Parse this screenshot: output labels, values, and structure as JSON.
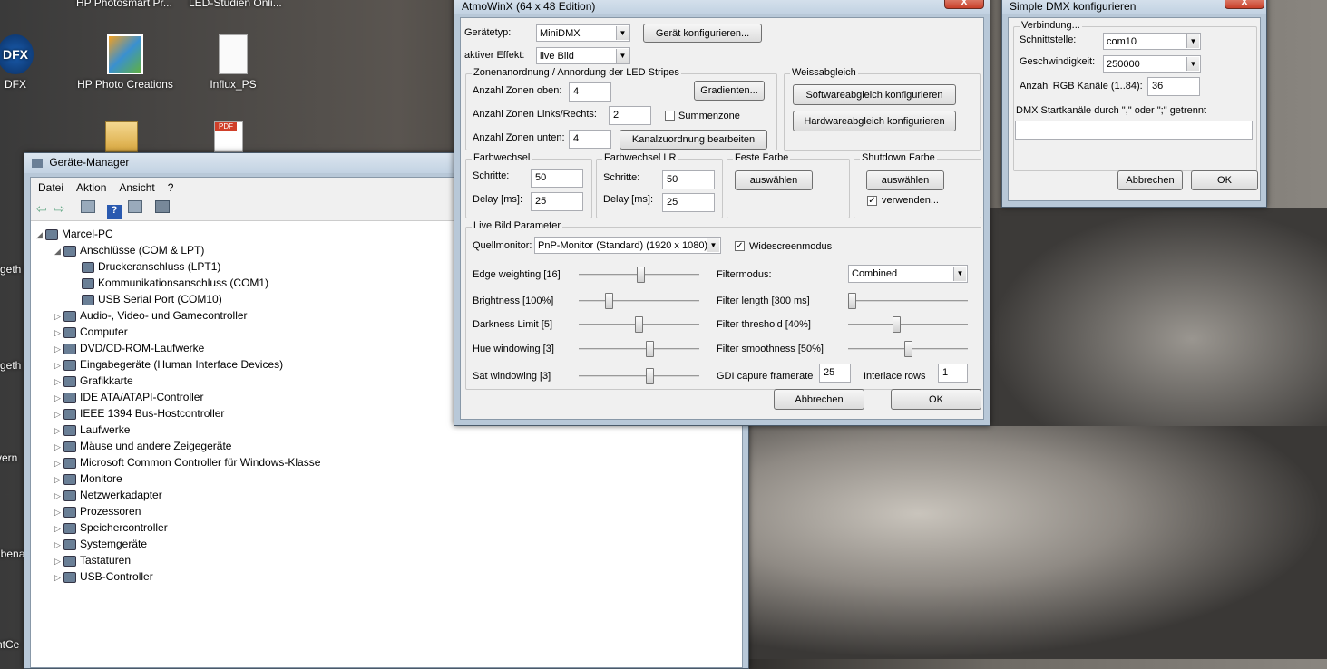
{
  "desktop": {
    "top_labels": [
      "HP Photosmart Pr...",
      "LED-Studien Onli..."
    ],
    "icons": [
      {
        "label": "DFX"
      },
      {
        "label": "HP Photo Creations"
      },
      {
        "label": "Influx_PS"
      }
    ],
    "edge_labels": [
      "rgeth",
      "rgeth",
      "vern",
      "nbena",
      "ntCe"
    ]
  },
  "device_manager": {
    "title": "Geräte-Manager",
    "menu": [
      "Datei",
      "Aktion",
      "Ansicht",
      "?"
    ],
    "root": "Marcel-PC",
    "expanded": {
      "label": "Anschlüsse (COM & LPT)",
      "children": [
        "Druckeranschluss (LPT1)",
        "Kommunikationsanschluss (COM1)",
        "USB Serial Port (COM10)"
      ]
    },
    "categories": [
      "Audio-, Video- und Gamecontroller",
      "Computer",
      "DVD/CD-ROM-Laufwerke",
      "Eingabegeräte (Human Interface Devices)",
      "Grafikkarte",
      "IDE ATA/ATAPI-Controller",
      "IEEE 1394 Bus-Hostcontroller",
      "Laufwerke",
      "Mäuse und andere Zeigegeräte",
      "Microsoft Common Controller für Windows-Klasse",
      "Monitore",
      "Netzwerkadapter",
      "Prozessoren",
      "Speichercontroller",
      "Systemgeräte",
      "Tastaturen",
      "USB-Controller"
    ]
  },
  "atmo": {
    "title": "AtmoWinX (64 x 48 Edition)",
    "close": "x",
    "geraetetyp_label": "Gerätetyp:",
    "geraetetyp_value": "MiniDMX",
    "geraet_btn": "Gerät konfigurieren...",
    "effekt_label": "aktiver Effekt:",
    "effekt_value": "live Bild",
    "zonen_title": "Zonenanordnung / Annordung der LED Stripes",
    "zonen_oben_label": "Anzahl Zonen oben:",
    "zonen_oben": "4",
    "gradienten_btn": "Gradienten...",
    "zonen_lr_label": "Anzahl Zonen Links/Rechts:",
    "zonen_lr": "2",
    "summenzone": "Summenzone",
    "zonen_unten_label": "Anzahl Zonen unten:",
    "zonen_unten": "4",
    "kanal_btn": "Kanalzuordnung bearbeiten",
    "weiss_title": "Weissabgleich",
    "software_btn": "Softwareabgleich konfigurieren",
    "hardware_btn": "Hardwareabgleich konfigurieren",
    "farbwechsel_title": "Farbwechsel",
    "schritte_label": "Schritte:",
    "delay_label": "Delay [ms]:",
    "fw_schritte": "50",
    "fw_delay": "25",
    "farbwechsel_lr_title": "Farbwechsel LR",
    "fwlr_schritte": "50",
    "fwlr_delay": "25",
    "feste_title": "Feste Farbe",
    "auswaehlen": "auswählen",
    "shutdown_title": "Shutdown Farbe",
    "verwenden": "verwenden...",
    "live_title": "Live Bild Parameter",
    "quell_label": "Quellmonitor:",
    "quell_value": "PnP-Monitor (Standard) (1920 x 1080)",
    "widescreen": "Widescreenmodus",
    "sliders_left": [
      {
        "label": "Edge weighting [16]",
        "level": 0.52
      },
      {
        "label": "Brightness [100%]",
        "level": 0.23
      },
      {
        "label": "Darkness Limit [5]",
        "level": 0.5
      },
      {
        "label": "Hue windowing [3]",
        "level": 0.6
      },
      {
        "label": "Sat windowing [3]",
        "level": 0.6
      }
    ],
    "filtermodus_label": "Filtermodus:",
    "filtermodus_value": "Combined",
    "sliders_right": [
      {
        "label": "Filter length [300 ms]",
        "level": 0.0
      },
      {
        "label": "Filter threshold [40%]",
        "level": 0.4
      },
      {
        "label": "Filter smoothness [50%]",
        "level": 0.5
      }
    ],
    "gdi_label": "GDI capure framerate",
    "gdi_value": "25",
    "interlace_label": "Interlace rows",
    "interlace_value": "1",
    "abbrechen": "Abbrechen",
    "ok": "OK"
  },
  "dmx": {
    "title": "Simple DMX  konfigurieren",
    "group": "Verbindung...",
    "schnitt_label": "Schnittstelle:",
    "schnitt_value": "com10",
    "geschw_label": "Geschwindigkeit:",
    "geschw_value": "250000",
    "rgb_label": "Anzahl RGB Kanäle (1..84):",
    "rgb_value": "36",
    "start_label": "DMX Startkanäle durch \",\" oder \";\" getrennt",
    "start_value": "",
    "abbrechen": "Abbrechen",
    "ok": "OK"
  }
}
